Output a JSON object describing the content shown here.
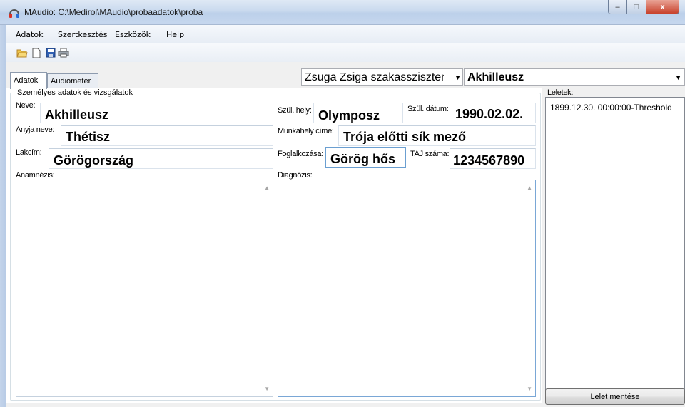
{
  "window": {
    "title": "MAudio: C:\\Medirol\\MAudio\\probaadatok\\proba",
    "min": "–",
    "max": "□",
    "close": "x"
  },
  "menu": {
    "items": [
      "Adatok",
      "Szertkesztés",
      "Eszközök",
      "Help"
    ]
  },
  "toolbar": {
    "icons": [
      "open-folder-icon",
      "new-document-icon",
      "save-icon",
      "print-icon"
    ]
  },
  "tabs": [
    "Adatok",
    "Audiometer"
  ],
  "header": {
    "assistant": "Zsuga Zsiga szakasszisztens",
    "patient": "Akhilleusz"
  },
  "group": {
    "title": "Személyes adatok és vizsgálatok"
  },
  "fields": {
    "neve_label": "Neve:",
    "neve": "Akhilleusz",
    "szul_hely_label": "Szül. hely:",
    "szul_hely": "Olymposz",
    "szul_datum_label": "Szül. dátum:",
    "szul_datum": "1990.02.02.",
    "anyja_label": "Anyja neve:",
    "anyja": "Thétisz",
    "munkahely_label": "Munkahely címe:",
    "munkahely": "Trója előtti sík mező",
    "lakcim_label": "Lakcím:",
    "lakcim": "Görögország",
    "foglalkozas_label": "Foglalkozása:",
    "foglalkozas": "Görög hős",
    "taj_label": "TAJ száma:",
    "taj": "1234567890",
    "anamnezis_label": "Anamnézis:",
    "diagnozis_label": "Diagnózis:"
  },
  "leletek": {
    "label": "Leletek:",
    "items": [
      "1899.12.30. 00:00:00-Threshold"
    ],
    "save_button": "Lelet mentése"
  }
}
